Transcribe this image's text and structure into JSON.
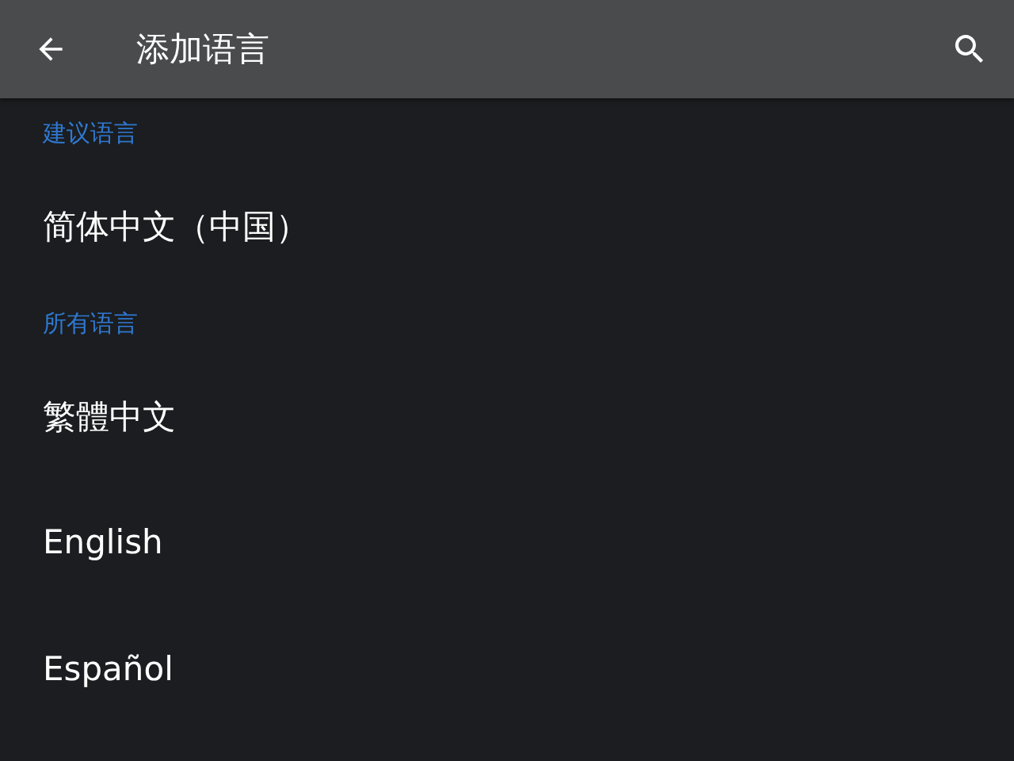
{
  "app_bar": {
    "title": "添加语言"
  },
  "sections": [
    {
      "header": "建议语言",
      "items": [
        {
          "label": "简体中文（中国）"
        }
      ]
    },
    {
      "header": "所有语言",
      "items": [
        {
          "label": "繁體中文"
        },
        {
          "label": "English"
        },
        {
          "label": "Español"
        }
      ]
    }
  ]
}
